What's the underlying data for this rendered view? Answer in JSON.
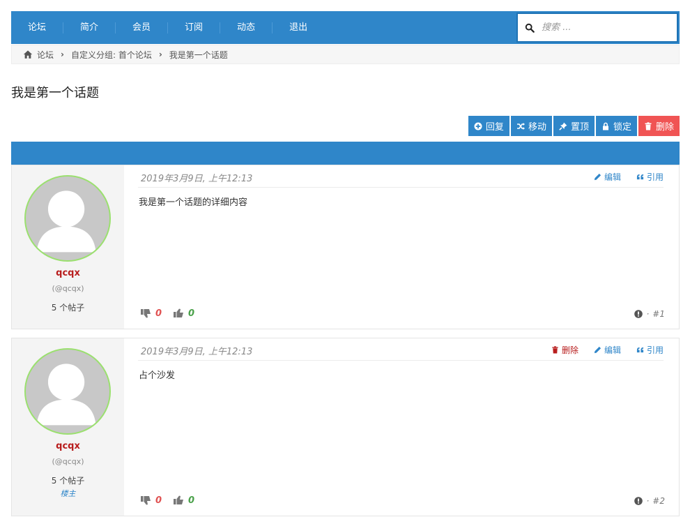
{
  "nav": {
    "items": [
      "论坛",
      "简介",
      "会员",
      "订阅",
      "动态",
      "退出"
    ],
    "search_placeholder": "搜索 ..."
  },
  "breadcrumb": {
    "home_icon": "home-icon",
    "items": [
      "论坛",
      "自定义分组: 首个论坛",
      "我是第一个话题"
    ]
  },
  "topic": {
    "title": "我是第一个话题"
  },
  "actions": {
    "reply": "回复",
    "move": "移动",
    "pin": "置顶",
    "lock": "锁定",
    "delete": "删除"
  },
  "posts": [
    {
      "username": "qcqx",
      "handle": "(@qcqx)",
      "post_count": "5 个帖子",
      "role": "",
      "date": "2019年3月9日, 上午12:13",
      "tools": {
        "delete": "",
        "edit": "编辑",
        "quote": "引用"
      },
      "body": "我是第一个话题的详细内容",
      "downvotes": "0",
      "upvotes": "0",
      "dot": "·",
      "index": "#1"
    },
    {
      "username": "qcqx",
      "handle": "(@qcqx)",
      "post_count": "5 个帖子",
      "role": "楼主",
      "date": "2019年3月9日, 上午12:13",
      "tools": {
        "delete": "删除",
        "edit": "编辑",
        "quote": "引用"
      },
      "body": "占个沙发",
      "downvotes": "0",
      "upvotes": "0",
      "dot": "·",
      "index": "#2"
    }
  ],
  "colors": {
    "primary": "#2f86c9",
    "danger": "#f05454",
    "username": "#b81d1d",
    "avatar_border": "#9be06f"
  }
}
